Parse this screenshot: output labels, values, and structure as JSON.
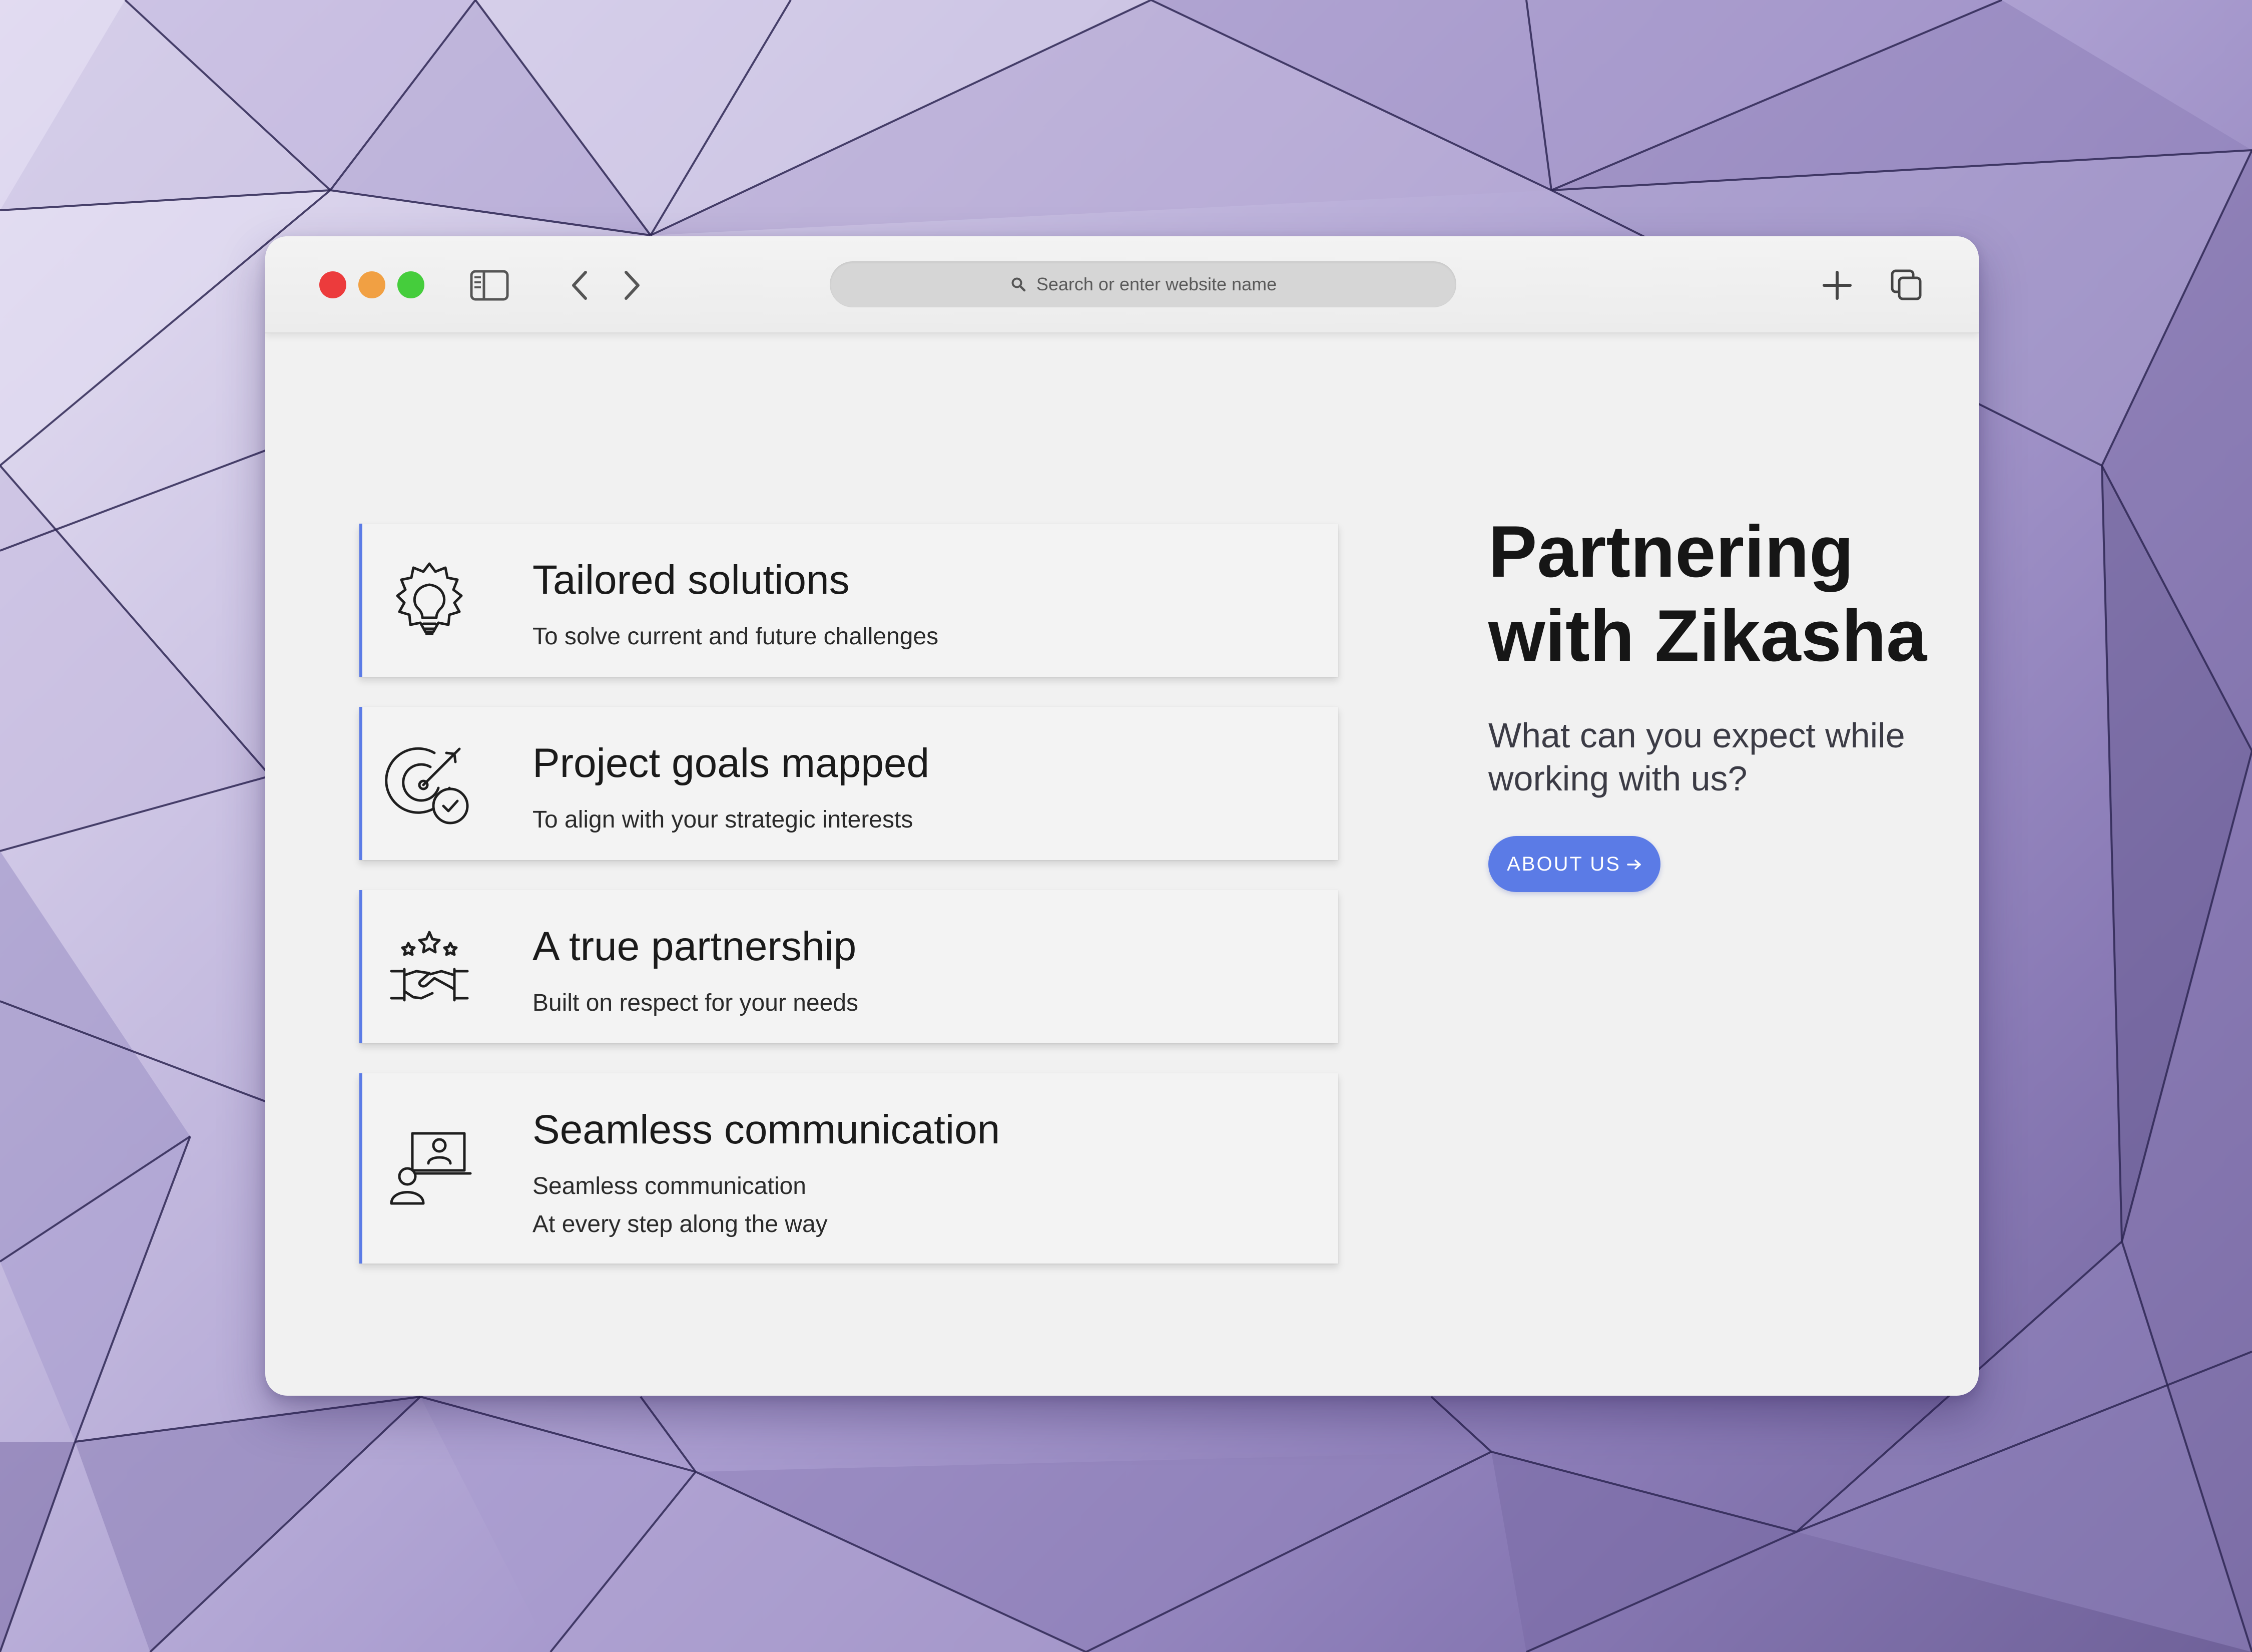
{
  "browser": {
    "address_bar": {
      "placeholder": "Search or enter website name",
      "icon": "search-icon"
    },
    "controls": {
      "window_buttons": [
        "close-button",
        "minimize-button",
        "maximize-button"
      ],
      "icons": [
        "sidebar-toggle-icon",
        "back-arrow-icon",
        "forward-arrow-icon",
        "plus-icon",
        "tabs-overview-icon"
      ]
    },
    "colors": {
      "close": "#ec3b3c",
      "minimize": "#f1a043",
      "maximize": "#45cd3c"
    }
  },
  "page": {
    "accent_color": "#5b7be6",
    "hero": {
      "title": "Partnering with Zikasha",
      "subtitle": "What can you expect while working with us?",
      "button_label": "ABOUT US",
      "button_icon": "arrow-right-icon"
    },
    "features": [
      {
        "icon": "lightbulb-gear-icon",
        "title": "Tailored solutions",
        "lines": [
          "To solve current and future challenges"
        ]
      },
      {
        "icon": "target-check-icon",
        "title": "Project goals mapped",
        "lines": [
          "To align with your strategic interests"
        ]
      },
      {
        "icon": "handshake-stars-icon",
        "title": "A true partnership",
        "lines": [
          "Built on respect for your needs"
        ]
      },
      {
        "icon": "video-call-icon",
        "title": "Seamless communication",
        "lines": [
          "Seamless communication",
          "At every step along the way"
        ]
      }
    ]
  }
}
